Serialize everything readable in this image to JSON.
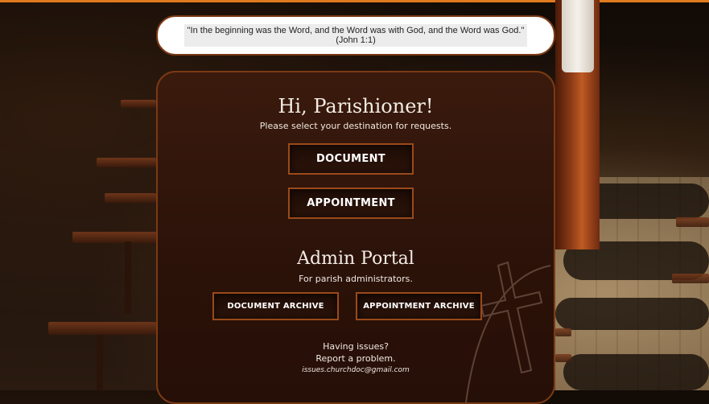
{
  "quote": {
    "text": "\"In the beginning was the Word, and the Word was with God, and the Word was God.\"",
    "reference": "(John 1:1)"
  },
  "greeting": {
    "title": "Hi, Parishioner!",
    "subtitle": "Please select your destination for requests."
  },
  "buttons": {
    "document": "DOCUMENT",
    "appointment": "APPOINTMENT"
  },
  "admin": {
    "title": "Admin Portal",
    "subtitle": "For parish administrators.",
    "document_archive": "DOCUMENT ARCHIVE",
    "appointment_archive": "APPOINTMENT ARCHIVE"
  },
  "support": {
    "line1": "Having issues?",
    "line2": "Report a problem.",
    "email": "issues.churchdoc@gmail.com"
  },
  "colors": {
    "accent": "#e07a1f",
    "border": "#9a4a1a",
    "panel": "#2b1209"
  }
}
